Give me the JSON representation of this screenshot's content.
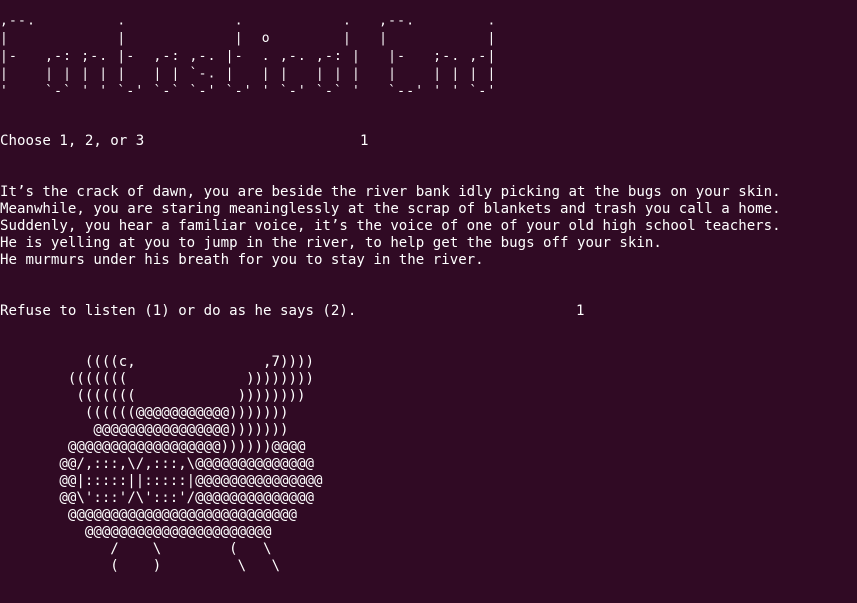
{
  "terminal": {
    "background": "#300a24",
    "foreground": "#ffffff",
    "banner": ",--.         .            .           .   ,--.        .\n|            |            |  o        |   |           |\n|-   ,-: ;-. |-  ,-: ,-. |-  . ,-. ,-: |   |-   ;-. ,-|\n|    | | | | |   | | `-. |   | |   | | |   |    | | | |\n'    `-` ' ' `-' `-` `-' `-' ' `-' `-` '   `--' ' ' `-'",
    "prompt1": "Choose 1, 2, or 3",
    "answer1": "1",
    "story": [
      "It’s the crack of dawn, you are beside the river bank idly picking at the bugs on your skin.",
      "Meanwhile, you are staring meaninglessly at the scrap of blankets and trash you call a home.",
      "Suddenly, you hear a familiar voice, it’s the voice of one of your old high school teachers.",
      "He is yelling at you to jump in the river, to help get the bugs off your skin.",
      "He murmurs under his breath for you to stay in the river."
    ],
    "prompt2": "Refuse to listen (1) or do as he says (2).",
    "answer2": "1",
    "ascii_art": "          ((((c,               ,7))))\n        (((((((              ))))))))\n         (((((((            ))))))))\n          ((((((@@@@@@@@@@@)))))))\n           @@@@@@@@@@@@@@@@)))))))\n        @@@@@@@@@@@@@@@@@@))))))@@@@\n       @@/,:::,\\/,:::,\\@@@@@@@@@@@@@@\n       @@|:::::||:::::|@@@@@@@@@@@@@@@\n       @@\\':::'/\\':::'/@@@@@@@@@@@@@@\n        @@@@@@@@@@@@@@@@@@@@@@@@@@@\n          @@@@@@@@@@@@@@@@@@@@@@\n             /    \\        (   \\\n             (    )         \\   \\"
  }
}
